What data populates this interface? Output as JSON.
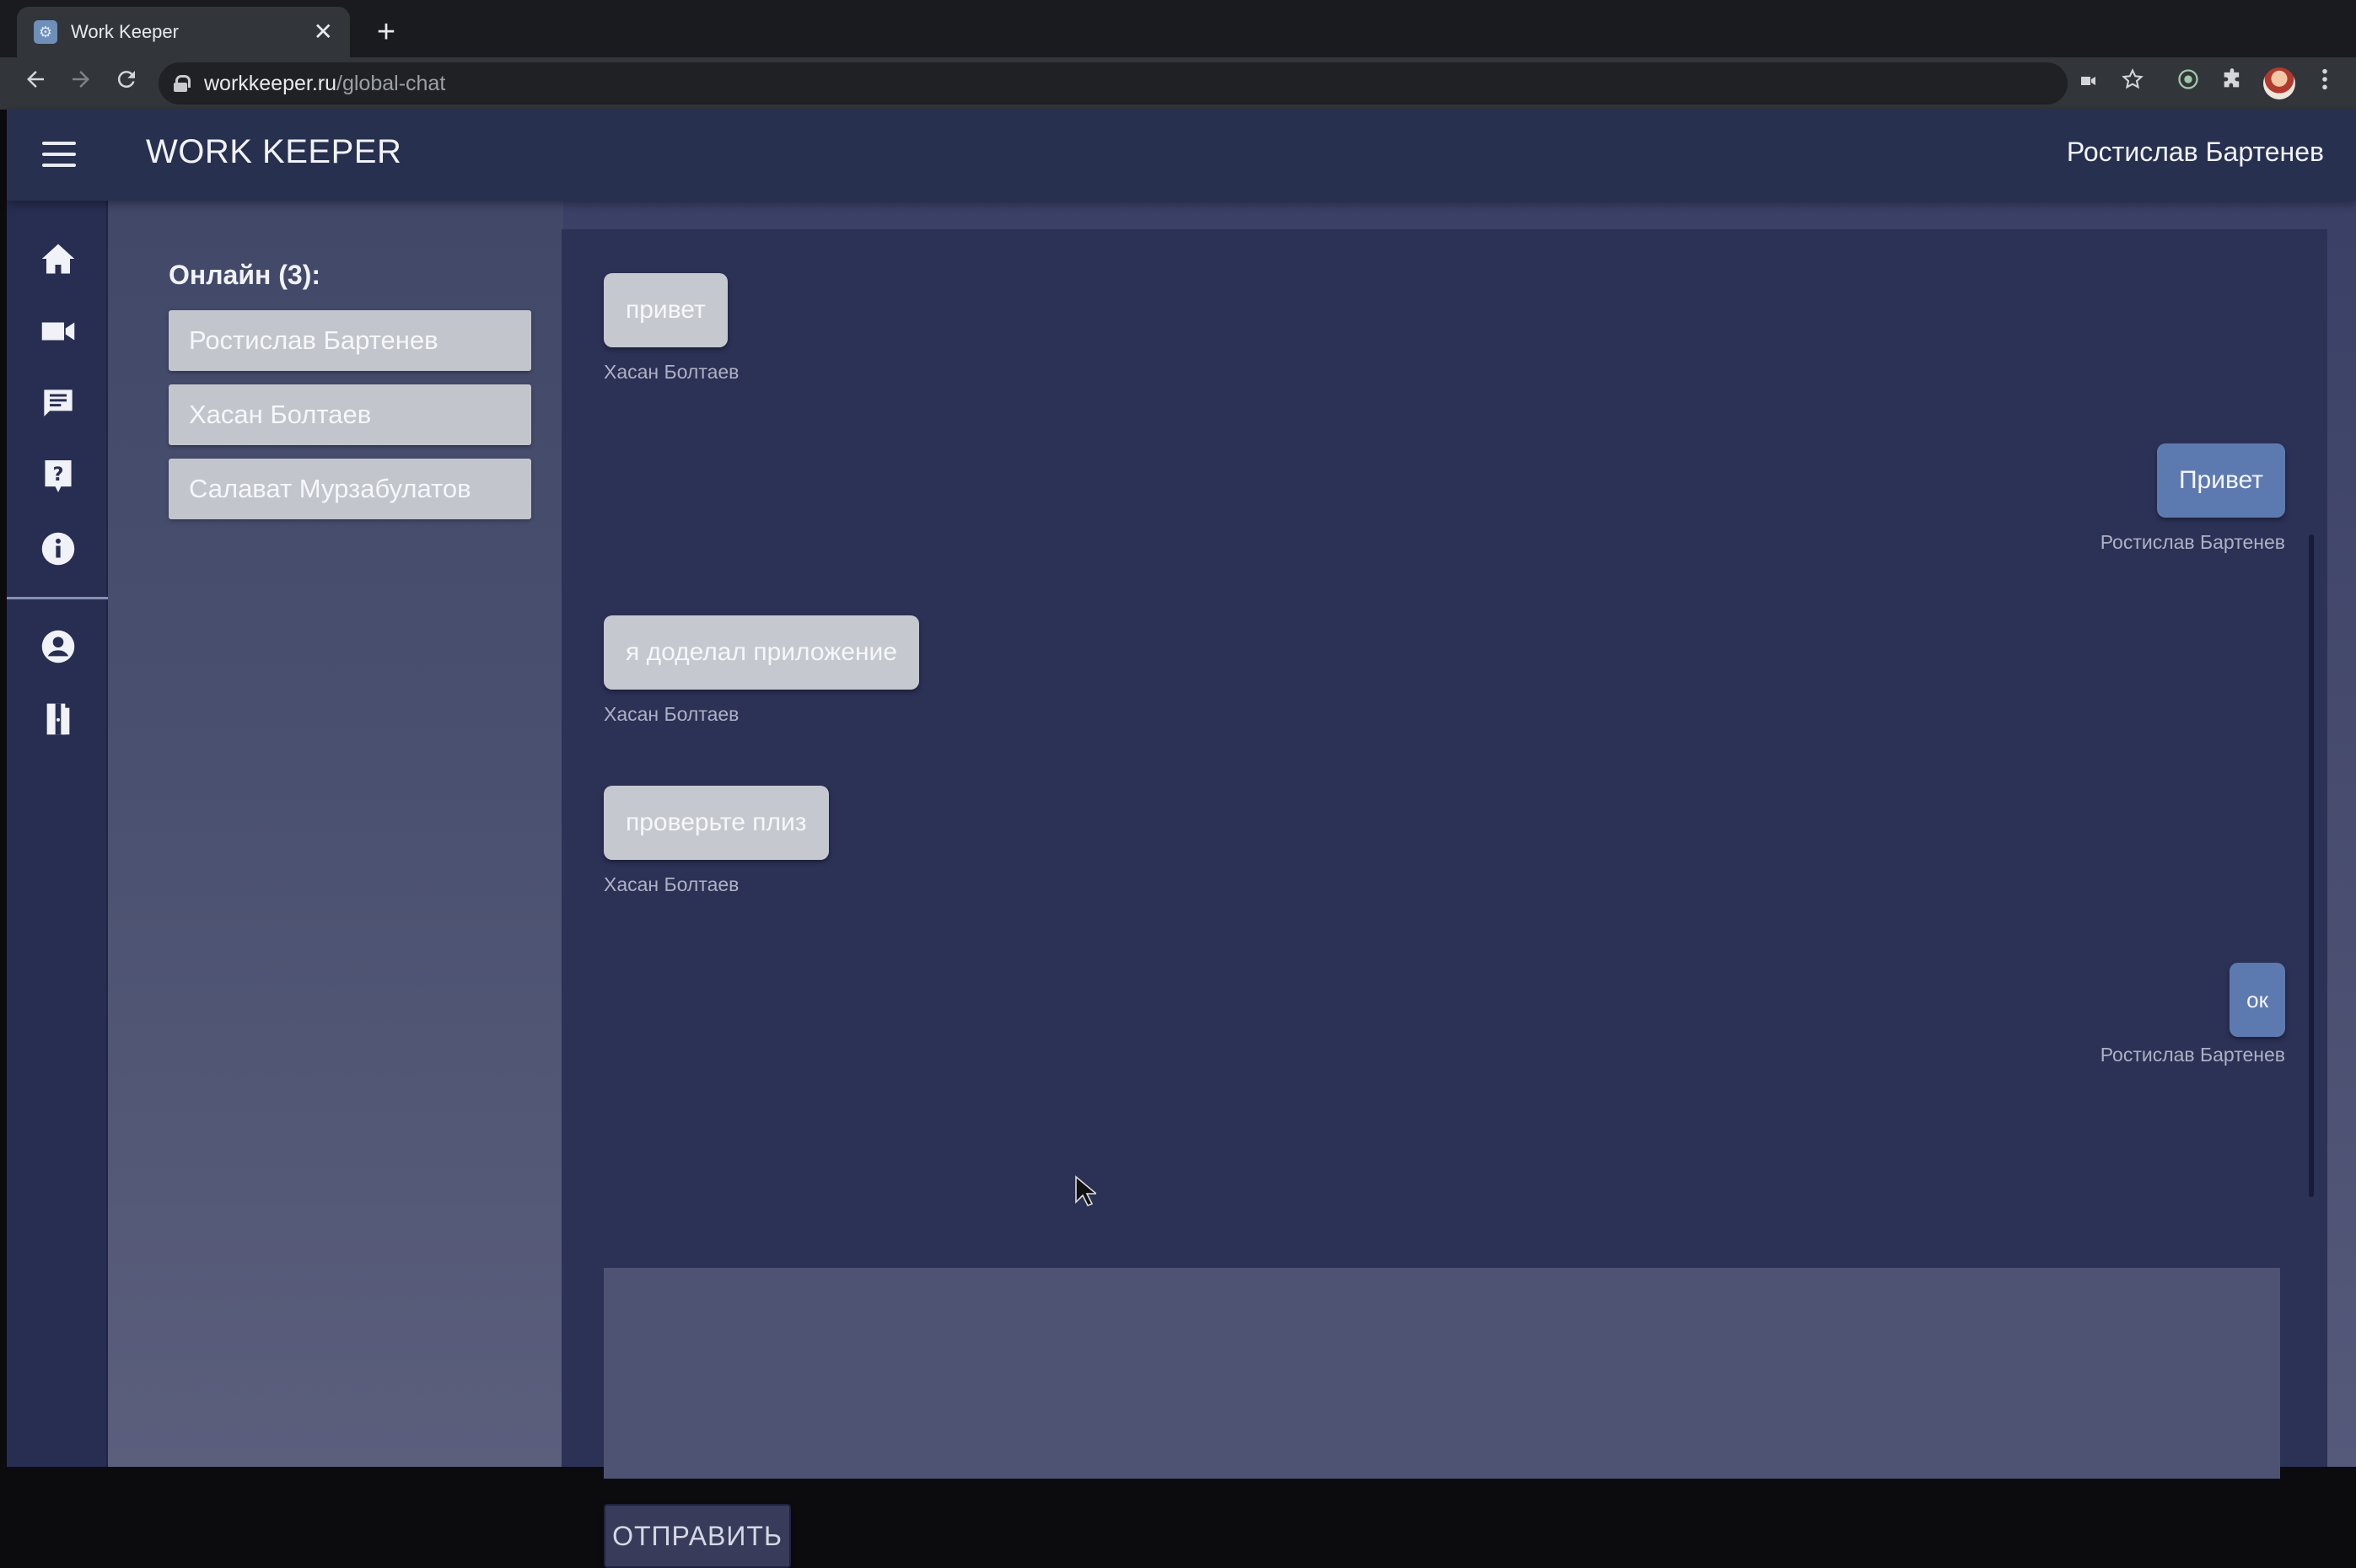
{
  "browser": {
    "tab_title": "Work Keeper",
    "tab_close": "✕",
    "new_tab": "+",
    "url_host": "workkeeper.ru",
    "url_path": "/global-chat"
  },
  "appbar": {
    "title": "WORK KEEPER",
    "user_name": "Ростислав Бартенев"
  },
  "sidenav": {
    "icons": [
      "home-icon",
      "video-camera-icon",
      "chat-icon",
      "help-icon",
      "info-icon",
      "account-icon",
      "logout-icon"
    ]
  },
  "online": {
    "title": "Онлайн (3):",
    "users": [
      "Ростислав Бартенев",
      "Хасан Болтаев",
      "Салават Мурзабулатов"
    ]
  },
  "messages": [
    {
      "text": "привет",
      "author": "Хасан Болтаев",
      "side": "theirs"
    },
    {
      "text": "Привет",
      "author": "Ростислав Бартенев",
      "side": "mine"
    },
    {
      "text": "я доделал приложение",
      "author": "Хасан Болтаев",
      "side": "theirs"
    },
    {
      "text": "проверьте плиз",
      "author": "Хасан Болтаев",
      "side": "theirs"
    },
    {
      "text": "ок",
      "author": "Ростислав Бартенев",
      "side": "mine"
    }
  ],
  "composer": {
    "input_value": "",
    "send_label": "ОТПРАВИТЬ"
  },
  "colors": {
    "appbar": "#27304f",
    "chat_background": "#2c3156",
    "my_message": "#5d7ab0",
    "their_message": "#c6c8d0"
  }
}
